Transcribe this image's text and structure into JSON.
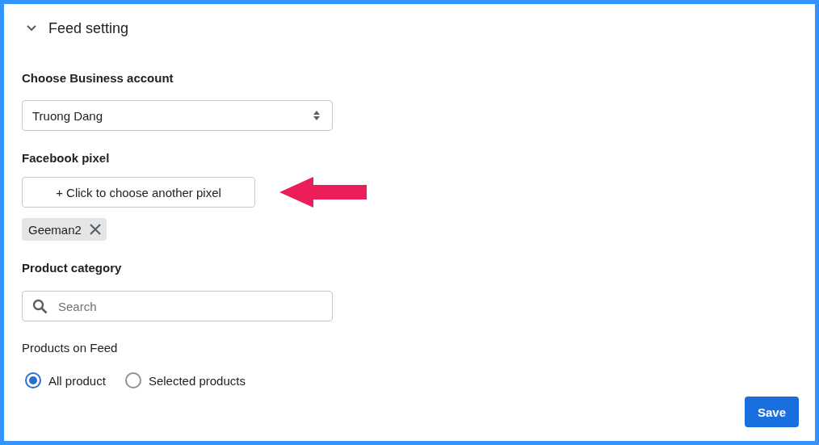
{
  "section": {
    "title": "Feed setting",
    "expanded": true
  },
  "business_account": {
    "label": "Choose Business account",
    "value": "Truong Dang"
  },
  "facebook_pixel": {
    "label": "Facebook pixel",
    "button": "+ Click to choose another pixel",
    "tags": [
      {
        "label": "Geeman2"
      }
    ]
  },
  "product_category": {
    "label": "Product category",
    "placeholder": "Search"
  },
  "products_on_feed": {
    "label": "Products on Feed",
    "options": [
      {
        "label": "All product",
        "selected": true
      },
      {
        "label": "Selected products",
        "selected": false
      }
    ]
  },
  "save_button": "Save"
}
